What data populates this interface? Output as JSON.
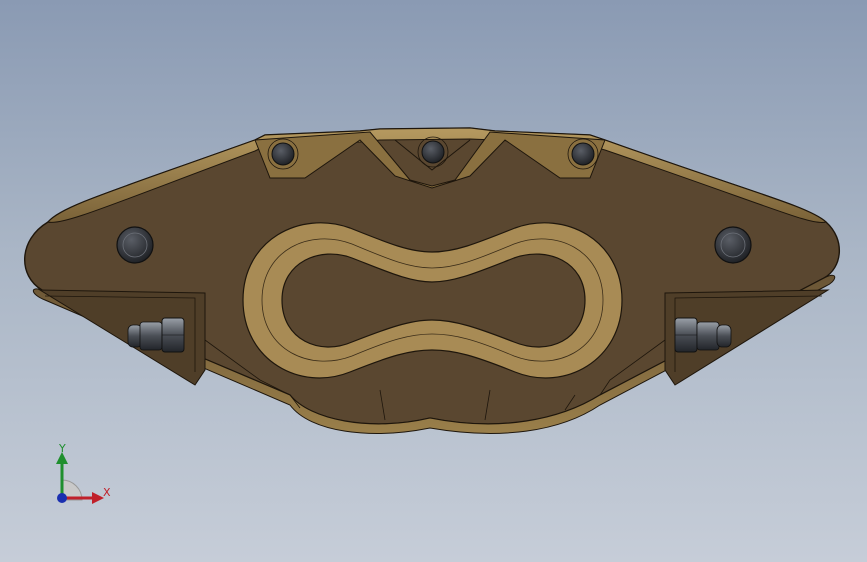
{
  "viewport": {
    "background_top": "#8a9ab3",
    "background_bottom": "#c6cdd8",
    "model": {
      "fill": "#5a4730",
      "edge": "#1e160c",
      "highlight": "#a68a55"
    }
  },
  "triad": {
    "x_label": "X",
    "y_label": "Y",
    "x_color": "#c0202a",
    "y_color": "#1f8f2e",
    "z_color": "#1a2fb0"
  }
}
